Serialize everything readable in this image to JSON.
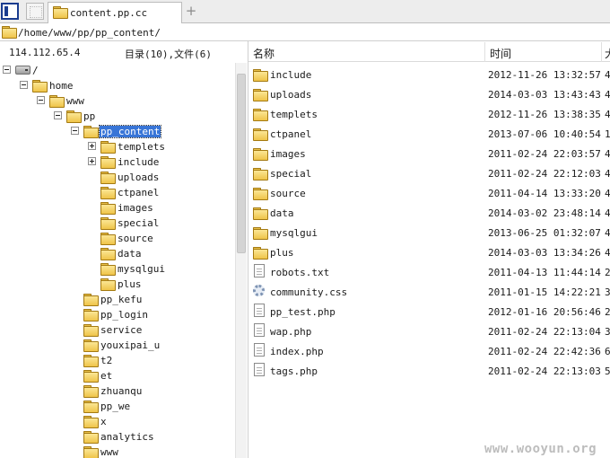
{
  "tab": {
    "title": "content.pp.cc",
    "new_tab_symbol": "+"
  },
  "path_bar": {
    "path": "/home/www/pp/pp_content/"
  },
  "info": {
    "ip": "114.112.65.4",
    "counts": "目录(10),文件(6)"
  },
  "list_header": {
    "name": "名称",
    "time": "时间",
    "extra": "大"
  },
  "tree": [
    {
      "label": "/",
      "icon": "drive-icon",
      "expander": "minus"
    },
    {
      "label": "home",
      "icon": "folder-icon",
      "expander": "minus"
    },
    {
      "label": "www",
      "icon": "folder-icon",
      "expander": "minus"
    },
    {
      "label": "pp",
      "icon": "folder-icon",
      "expander": "minus"
    },
    {
      "label": "pp_content",
      "icon": "folder-icon",
      "expander": "minus",
      "selected": true
    },
    {
      "label": "templets",
      "icon": "folder-icon",
      "expander": "plus"
    },
    {
      "label": "include",
      "icon": "folder-icon",
      "expander": "plus"
    },
    {
      "label": "uploads",
      "icon": "folder-icon",
      "expander": "none"
    },
    {
      "label": "ctpanel",
      "icon": "folder-icon",
      "expander": "none"
    },
    {
      "label": "images",
      "icon": "folder-icon",
      "expander": "none"
    },
    {
      "label": "special",
      "icon": "folder-icon",
      "expander": "none"
    },
    {
      "label": "source",
      "icon": "folder-icon",
      "expander": "none"
    },
    {
      "label": "data",
      "icon": "folder-icon",
      "expander": "none"
    },
    {
      "label": "mysqlgui",
      "icon": "folder-icon",
      "expander": "none"
    },
    {
      "label": "plus",
      "icon": "folder-icon",
      "expander": "none"
    },
    {
      "label": "pp_kefu",
      "icon": "folder-icon",
      "expander": "none"
    },
    {
      "label": "pp_login",
      "icon": "folder-icon",
      "expander": "none"
    },
    {
      "label": "service",
      "icon": "folder-icon",
      "expander": "none"
    },
    {
      "label": "youxipai_u",
      "icon": "folder-icon",
      "expander": "none"
    },
    {
      "label": "t2",
      "icon": "folder-icon",
      "expander": "none"
    },
    {
      "label": "et",
      "icon": "folder-icon",
      "expander": "none"
    },
    {
      "label": "zhuanqu",
      "icon": "folder-icon",
      "expander": "none"
    },
    {
      "label": "pp_we",
      "icon": "folder-icon",
      "expander": "none"
    },
    {
      "label": "x",
      "icon": "folder-icon",
      "expander": "none"
    },
    {
      "label": "analytics",
      "icon": "folder-icon",
      "expander": "none"
    },
    {
      "label": "www",
      "icon": "folder-icon",
      "expander": "none"
    }
  ],
  "files": [
    {
      "name": "include",
      "time": "2012-11-26 13:32:57",
      "extra": "4",
      "icon": "folder-icon"
    },
    {
      "name": "uploads",
      "time": "2014-03-03 13:43:43",
      "extra": "4",
      "icon": "folder-icon"
    },
    {
      "name": "templets",
      "time": "2012-11-26 13:38:35",
      "extra": "4",
      "icon": "folder-icon"
    },
    {
      "name": "ctpanel",
      "time": "2013-07-06 10:40:54",
      "extra": "1",
      "icon": "folder-icon"
    },
    {
      "name": "images",
      "time": "2011-02-24 22:03:57",
      "extra": "4",
      "icon": "folder-icon"
    },
    {
      "name": "special",
      "time": "2011-02-24 22:12:03",
      "extra": "4",
      "icon": "folder-icon"
    },
    {
      "name": "source",
      "time": "2011-04-14 13:33:20",
      "extra": "4",
      "icon": "folder-icon"
    },
    {
      "name": "data",
      "time": "2014-03-02 23:48:14",
      "extra": "4",
      "icon": "folder-icon"
    },
    {
      "name": "mysqlgui",
      "time": "2013-06-25 01:32:07",
      "extra": "4",
      "icon": "folder-icon"
    },
    {
      "name": "plus",
      "time": "2014-03-03 13:34:26",
      "extra": "4",
      "icon": "folder-icon"
    },
    {
      "name": "robots.txt",
      "time": "2011-04-13 11:44:14",
      "extra": "2",
      "icon": "text-file-icon"
    },
    {
      "name": "community.css",
      "time": "2011-01-15 14:22:21",
      "extra": "3",
      "icon": "css-file-icon"
    },
    {
      "name": "pp_test.php",
      "time": "2012-01-16 20:56:46",
      "extra": "2",
      "icon": "php-file-icon"
    },
    {
      "name": "wap.php",
      "time": "2011-02-24 22:13:04",
      "extra": "3",
      "icon": "php-file-icon"
    },
    {
      "name": "index.php",
      "time": "2011-02-24 22:42:36",
      "extra": "6",
      "icon": "php-file-icon"
    },
    {
      "name": "tags.php",
      "time": "2011-02-24 22:13:03",
      "extra": "5",
      "icon": "php-file-icon"
    }
  ],
  "watermark": "www.wooyun.org",
  "colors": {
    "selection": "#3875d7",
    "folder": "#efc449"
  }
}
